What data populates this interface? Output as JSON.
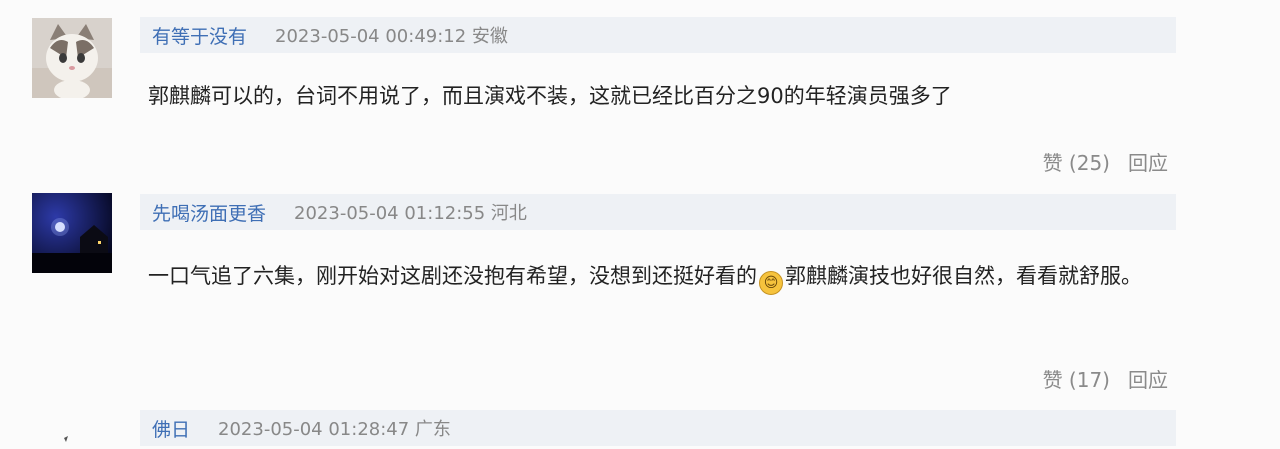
{
  "comments": [
    {
      "username": "有等于没有",
      "datetime": "2023-05-04 00:49:12",
      "location": "安徽",
      "text": "郭麒麟可以的，台词不用说了，而且演戏不装，这就已经比百分之90的年轻演员强多了",
      "like_label": "赞 (25)",
      "reply_label": "回应"
    },
    {
      "username": "先喝汤面更香",
      "datetime": "2023-05-04 01:12:55",
      "location": "河北",
      "text_before_emoji": "一口气追了六集，刚开始对这剧还没抱有希望，没想到还挺好看的",
      "emoji": "😊",
      "text_after_emoji": "郭麒麟演技也好很自然，看看就舒服。",
      "like_label": "赞 (17)",
      "reply_label": "回应"
    },
    {
      "username": "佛日",
      "datetime": "2023-05-04 01:28:47",
      "location": "广东"
    }
  ],
  "colors": {
    "username": "#3f6fb5",
    "meta_bar": "#eef1f5",
    "meta_text": "#888888",
    "body_text": "#222222"
  }
}
